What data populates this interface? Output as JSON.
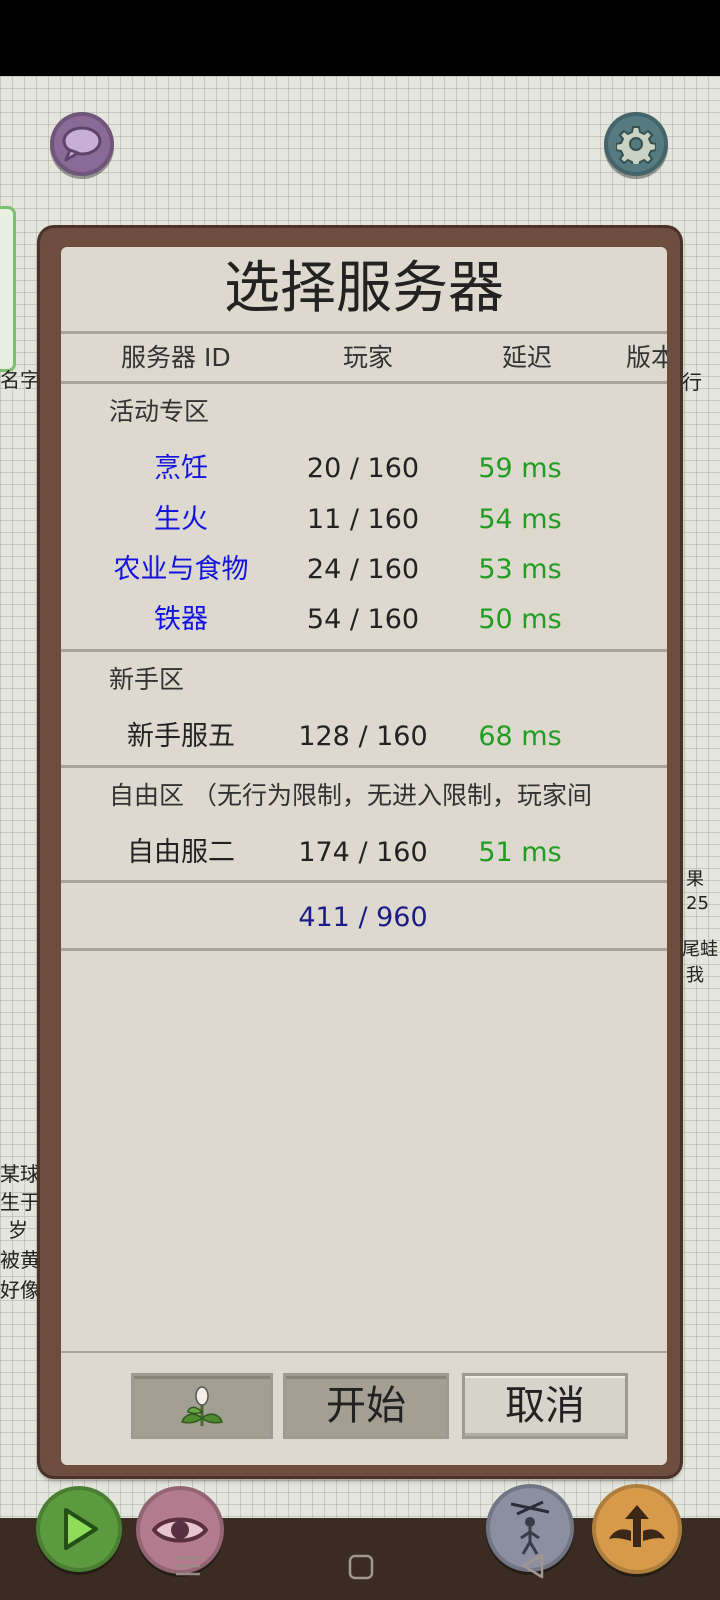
{
  "dialog": {
    "title": "选择服务器",
    "columns": [
      "服务器 ID",
      "玩家",
      "延迟",
      "版本"
    ],
    "sections": [
      {
        "title": "活动专区",
        "rows": [
          {
            "name": "烹饪",
            "players": "20 / 160",
            "ping": "59 ms",
            "color": "#1414e0"
          },
          {
            "name": "生火",
            "players": "11 / 160",
            "ping": "54 ms",
            "color": "#1414e0"
          },
          {
            "name": "农业与食物",
            "players": "24 / 160",
            "ping": "53 ms",
            "color": "#1414e0"
          },
          {
            "name": "铁器",
            "players": "54 / 160",
            "ping": "50 ms",
            "color": "#1414e0"
          }
        ]
      },
      {
        "title": "新手区",
        "rows": [
          {
            "name": "新手服五",
            "players": "128 / 160",
            "ping": "68 ms",
            "color": "#222222"
          }
        ]
      },
      {
        "title": "自由区 （无行为限制，无进入限制，玩家间",
        "rows": [
          {
            "name": "自由服二",
            "players": "174 / 160",
            "ping": "51 ms",
            "color": "#222222"
          }
        ]
      }
    ],
    "total": "411 / 960",
    "buttons": {
      "start": "开始",
      "cancel": "取消"
    }
  },
  "background_text": {
    "left_name": "名字",
    "right_top": "行",
    "right_mid": [
      "果",
      "25",
      "尾蛙",
      "我"
    ],
    "left_bottom": [
      "某球",
      "生于",
      "岁",
      "被黄扌",
      "好像"
    ]
  },
  "icons": [
    "chat-icon",
    "settings-gear-icon",
    "sprout-icon",
    "play-icon",
    "eye-icon",
    "puppet-icon",
    "wings-upgrade-icon",
    "nav-menu-icon",
    "nav-home-icon",
    "nav-back-icon"
  ]
}
